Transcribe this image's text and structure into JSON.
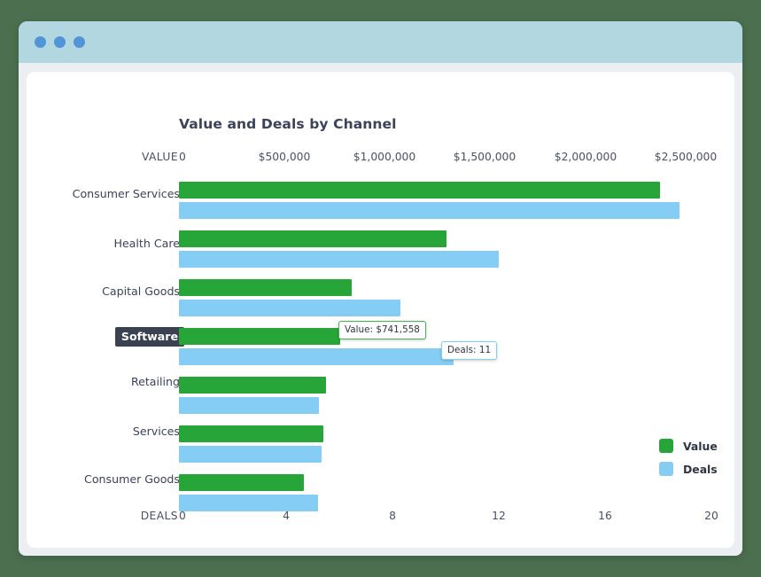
{
  "window": {
    "titlebar_dots": [
      "dot-red",
      "dot-yellow",
      "dot-green"
    ],
    "dot_color": "#5295d6",
    "titlebar_color": "#b3d7e0",
    "page_background": "#4c704f"
  },
  "chart_data": {
    "type": "bar",
    "orientation": "horizontal",
    "title": "Value and Deals by Channel",
    "categories": [
      "Consumer Services",
      "Health Care",
      "Capital Goods",
      "Software",
      "Retailing",
      "Services",
      "Consumer Goods"
    ],
    "highlighted_category": "Software",
    "series": [
      {
        "name": "Value",
        "color": "#28a539",
        "axis": "VALUE",
        "values": [
          2393000,
          1325000,
          855000,
          742000,
          720000,
          705000,
          610000
        ]
      },
      {
        "name": "Deals",
        "color": "#86cdf5",
        "axis": "DEALS",
        "values": [
          18.8,
          12.0,
          8.3,
          11.0,
          5.2,
          5.3,
          5.1
        ]
      }
    ],
    "axes": {
      "value": {
        "label": "VALUE",
        "position": "top",
        "ticks": [
          "0",
          "$500,000",
          "$1,000,000",
          "$1,500,000",
          "$2,000,000",
          "$2,500,000"
        ],
        "tick_values": [
          0,
          500000,
          1000000,
          1500000,
          2000000,
          2500000
        ],
        "range": [
          0,
          2650000
        ]
      },
      "deals": {
        "label": "DEALS",
        "position": "bottom",
        "ticks": [
          "0",
          "4",
          "8",
          "12",
          "16",
          "20"
        ],
        "tick_values": [
          0,
          4,
          8,
          12,
          16,
          20
        ],
        "range": [
          0,
          21
        ]
      }
    },
    "grid": false,
    "legend": {
      "position": "right",
      "entries": [
        {
          "label": "Value",
          "color": "#28a539"
        },
        {
          "label": "Deals",
          "color": "#86cdf5"
        }
      ]
    },
    "tooltips": [
      {
        "name": "value-tooltip",
        "text": "Value: $741,558",
        "series": "Value",
        "category": "Software"
      },
      {
        "name": "deals-tooltip",
        "text": "Deals: 11",
        "series": "Deals",
        "category": "Software"
      }
    ]
  }
}
